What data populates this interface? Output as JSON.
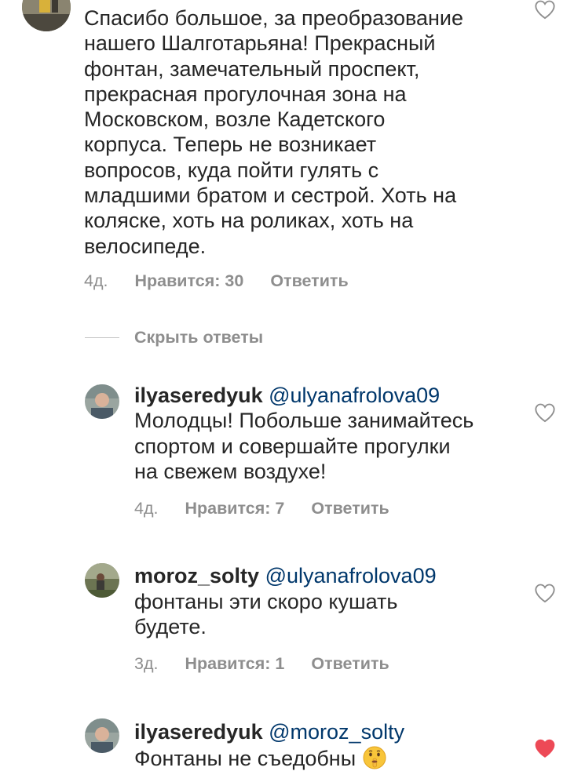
{
  "top_comment": {
    "text": "Спасибо большое, за преобразование\nнашего Шалготарьяна!  Прекрасный\nфонтан, замечательный проспект,\nпрекрасная прогулочная зона на\nМосковском, возле Кадетского\nкорпуса. Теперь не возникает\nвопросов, куда пойти гулять с\nмладшими братом и сестрой. Хоть на\nколяске, хоть на роликах, хоть на\nвелосипеде.",
    "age": "4д.",
    "likes": "Нравится: 30",
    "reply": "Ответить"
  },
  "hide_replies_label": "Скрыть ответы",
  "replies": [
    {
      "username": "ilyaseredyuk",
      "mention": "@ulyanafrolova09",
      "lines": [
        "Молодцы! Побольше занимайтесь",
        "спортом и совершайте прогулки",
        "на свежем воздухе!"
      ],
      "age": "4д.",
      "likes": "Нравится: 7",
      "reply": "Ответить",
      "liked": false
    },
    {
      "username": "moroz_solty",
      "mention": "@ulyanafrolova09",
      "lines": [
        "фонтаны эти скоро кушать",
        "будете."
      ],
      "age": "3д.",
      "likes": "Нравится: 1",
      "reply": "Ответить",
      "liked": false
    },
    {
      "username": "ilyaseredyuk",
      "mention": "@moroz_solty",
      "lines": [
        "Фонтаны не съедобны"
      ],
      "emoji": "shushing-face-emoji",
      "liked": true
    }
  ],
  "colors": {
    "text": "#262626",
    "secondary": "#8e8e8e",
    "mention": "#00376b",
    "liked_heart": "#ed4956"
  }
}
